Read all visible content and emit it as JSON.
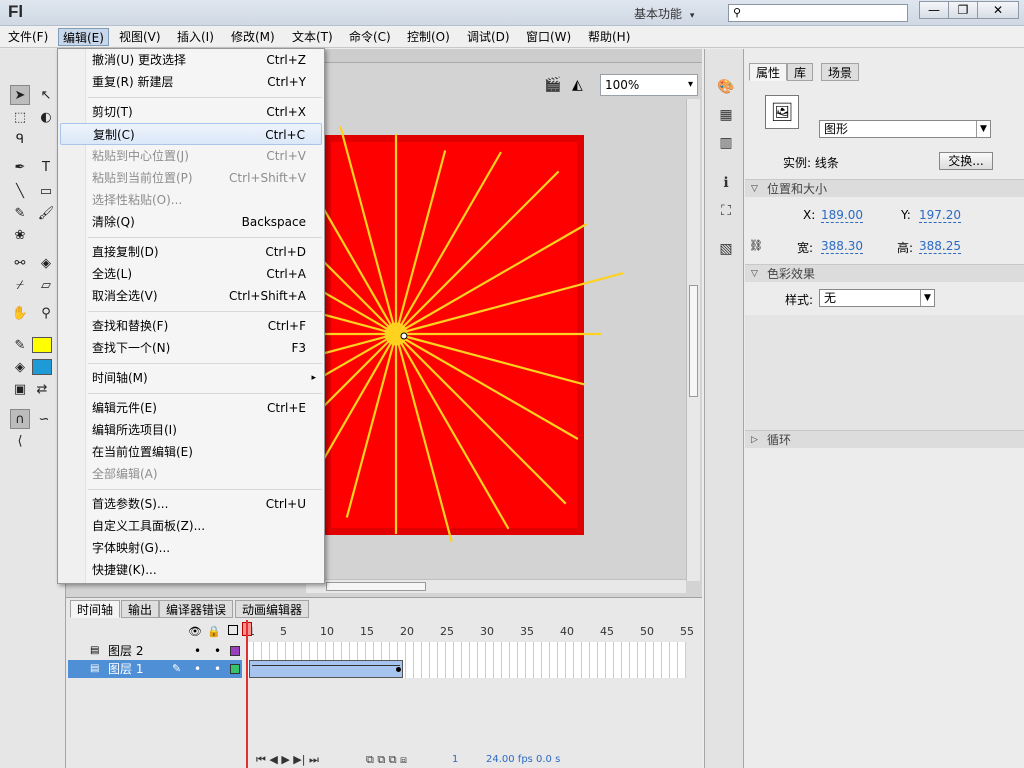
{
  "app": {
    "logo": "Fl",
    "workspace": "基本功能",
    "workspace_arrow": "▾",
    "search_placeholder": ""
  },
  "window_buttons": {
    "minimize": "—",
    "restore": "❐",
    "close": "✕"
  },
  "menubar": [
    "文件(F)",
    "编辑(E)",
    "视图(V)",
    "插入(I)",
    "修改(M)",
    "文本(T)",
    "命令(C)",
    "控制(O)",
    "调试(D)",
    "窗口(W)",
    "帮助(H)"
  ],
  "edit_menu": [
    {
      "label": "撤消(U) 更改选择",
      "shortcut": "Ctrl+Z",
      "state": "normal"
    },
    {
      "label": "重复(R) 新建层",
      "shortcut": "Ctrl+Y",
      "state": "normal"
    },
    {
      "label": "剪切(T)",
      "shortcut": "Ctrl+X",
      "state": "normal"
    },
    {
      "label": "复制(C)",
      "shortcut": "Ctrl+C",
      "state": "highlight"
    },
    {
      "label": "粘贴到中心位置(J)",
      "shortcut": "Ctrl+V",
      "state": "disabled"
    },
    {
      "label": "粘贴到当前位置(P)",
      "shortcut": "Ctrl+Shift+V",
      "state": "disabled"
    },
    {
      "label": "选择性粘贴(O)...",
      "shortcut": "",
      "state": "disabled"
    },
    {
      "label": "清除(Q)",
      "shortcut": "Backspace",
      "state": "normal"
    },
    {
      "label": "直接复制(D)",
      "shortcut": "Ctrl+D",
      "state": "normal"
    },
    {
      "label": "全选(L)",
      "shortcut": "Ctrl+A",
      "state": "normal"
    },
    {
      "label": "取消全选(V)",
      "shortcut": "Ctrl+Shift+A",
      "state": "normal"
    },
    {
      "label": "查找和替换(F)",
      "shortcut": "Ctrl+F",
      "state": "normal"
    },
    {
      "label": "查找下一个(N)",
      "shortcut": "F3",
      "state": "normal"
    },
    {
      "label": "时间轴(M)",
      "shortcut": "",
      "submenu": "▸",
      "state": "normal"
    },
    {
      "label": "编辑元件(E)",
      "shortcut": "Ctrl+E",
      "state": "normal"
    },
    {
      "label": "编辑所选项目(I)",
      "shortcut": "",
      "state": "normal"
    },
    {
      "label": "在当前位置编辑(E)",
      "shortcut": "",
      "state": "normal"
    },
    {
      "label": "全部编辑(A)",
      "shortcut": "",
      "state": "disabled"
    },
    {
      "label": "首选参数(S)...",
      "shortcut": "Ctrl+U",
      "state": "normal"
    },
    {
      "label": "自定义工具面板(Z)...",
      "shortcut": "",
      "state": "normal"
    },
    {
      "label": "字体映射(G)...",
      "shortcut": "",
      "state": "normal"
    },
    {
      "label": "快捷键(K)...",
      "shortcut": "",
      "state": "normal"
    }
  ],
  "stage": {
    "zoom": "100%",
    "zoom_arrow": "▾",
    "background_color": "#ff0000",
    "ray_color": "#ffd21f",
    "ray_count": 24
  },
  "colors": {
    "stroke": "#ffff00",
    "fill": "#1e9bd7"
  },
  "timeline": {
    "tabs": [
      "时间轴",
      "输出",
      "编译器错误",
      "动画编辑器"
    ],
    "ruler": [
      "1",
      "5",
      "10",
      "15",
      "20",
      "25",
      "30",
      "35",
      "40",
      "45",
      "50",
      "55"
    ],
    "layers": [
      {
        "name": "图层 2",
        "color": "#9b3fbf"
      },
      {
        "name": "图层 1",
        "color": "#35c26a"
      }
    ],
    "status": {
      "frame": "1",
      "fps": "24.00 fps",
      "time": "0.0 s"
    }
  },
  "properties": {
    "tabs": [
      "属性",
      "库",
      "场景"
    ],
    "type": "图形",
    "instance_label": "实例: 线条",
    "swap_button": "交换...",
    "section_position": "位置和大小",
    "x_label": "X:",
    "x": "189.00",
    "y_label": "Y:",
    "y": "197.20",
    "w_label": "宽:",
    "w": "388.30",
    "h_label": "高:",
    "h": "388.25",
    "section_color": "色彩效果",
    "style_label": "样式:",
    "style": "无",
    "section_loop": "循环"
  }
}
